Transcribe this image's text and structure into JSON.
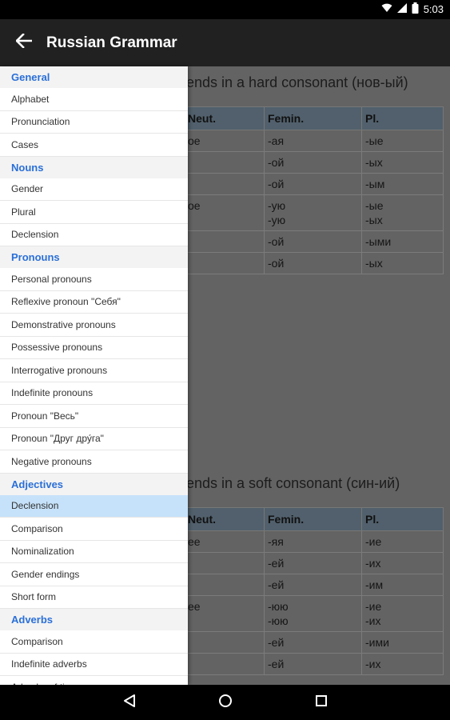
{
  "status_bar": {
    "time": "5:03"
  },
  "app_bar": {
    "title": "Russian Grammar"
  },
  "content": {
    "section1": {
      "heading": "ends in a hard consonant (нов-ый)",
      "headers": [
        "Neut.",
        "Femin.",
        "Pl."
      ],
      "rows": [
        [
          "ое",
          "-ая",
          "-ые"
        ],
        [
          "",
          "-ой",
          "-ых"
        ],
        [
          "",
          "-ой",
          "-ым"
        ],
        [
          "ое",
          "-ую\n-ую",
          "-ые\n-ых"
        ],
        [
          "",
          "-ой",
          "-ыми"
        ],
        [
          "",
          "-ой",
          "-ых"
        ]
      ]
    },
    "section2": {
      "heading": "ends in a soft consonant (син-ий)",
      "headers": [
        "Neut.",
        "Femin.",
        "Pl."
      ],
      "rows": [
        [
          "ее",
          "-яя",
          "-ие"
        ],
        [
          "",
          "-ей",
          "-их"
        ],
        [
          "",
          "-ей",
          "-им"
        ],
        [
          "ее",
          "-юю\n-юю",
          "-ие\n-их"
        ],
        [
          "",
          "-ей",
          "-ими"
        ],
        [
          "",
          "-ей",
          "-их"
        ]
      ]
    }
  },
  "drawer": {
    "sections": [
      {
        "title": "General",
        "items": [
          "Alphabet",
          "Pronunciation",
          "Cases"
        ]
      },
      {
        "title": "Nouns",
        "items": [
          "Gender",
          "Plural",
          "Declension"
        ]
      },
      {
        "title": "Pronouns",
        "items": [
          "Personal pronouns",
          "Reflexive pronoun \"Себя\"",
          "Demonstrative pronouns",
          "Possessive pronouns",
          "Interrogative pronouns",
          "Indefinite pronouns",
          "Pronoun \"Весь\"",
          "Pronoun \"Друг дру́га\"",
          "Negative pronouns"
        ]
      },
      {
        "title": "Adjectives",
        "items": [
          "Declension",
          "Comparison",
          "Nominalization",
          "Gender endings",
          "Short form"
        ]
      },
      {
        "title": "Adverbs",
        "items": [
          "Comparison",
          "Indefinite adverbs",
          "Adverbs of time"
        ]
      }
    ],
    "selected": "Adjectives/Declension"
  },
  "colors": {
    "accent": "#2a6fd8",
    "selected_bg": "#c6e2fa",
    "app_bar": "#212121"
  }
}
